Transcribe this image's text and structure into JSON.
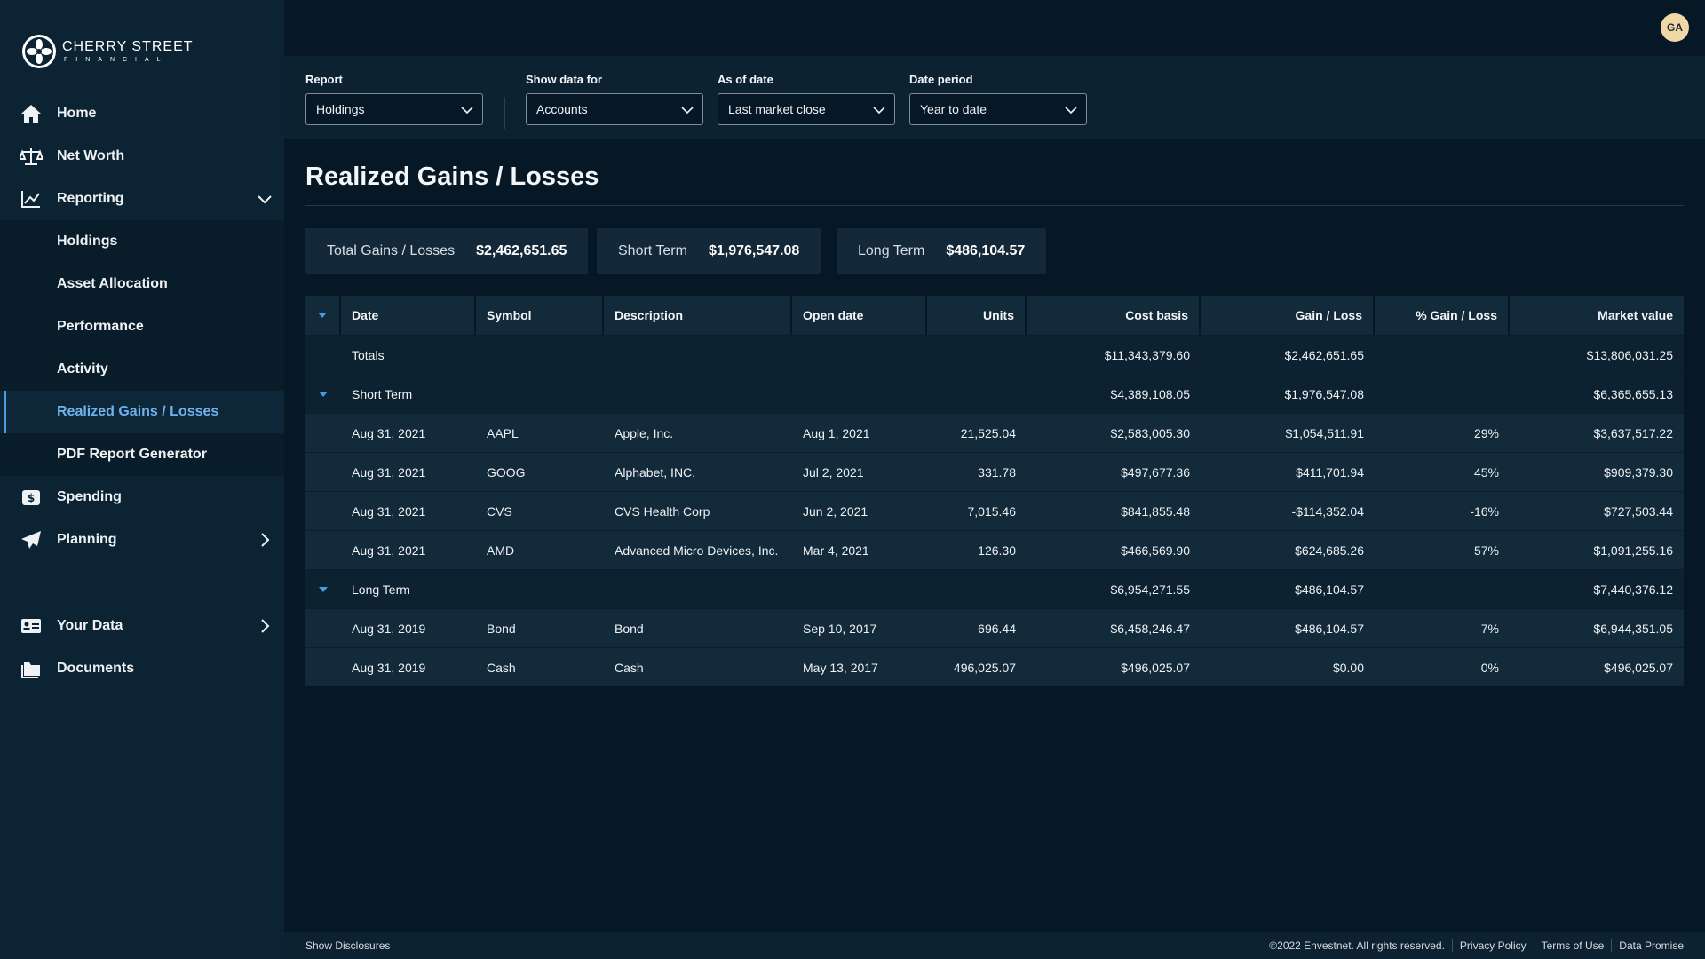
{
  "brand": {
    "line1": "CHERRY STREET",
    "line2": "FINANCIAL"
  },
  "user": {
    "initials": "GA"
  },
  "nav": {
    "home": "Home",
    "net_worth": "Net Worth",
    "reporting": "Reporting",
    "reporting_sub": [
      "Holdings",
      "Asset Allocation",
      "Performance",
      "Activity",
      "Realized Gains / Losses",
      "PDF Report Generator"
    ],
    "spending": "Spending",
    "planning": "Planning",
    "your_data": "Your Data",
    "documents": "Documents"
  },
  "filters": {
    "report": {
      "label": "Report",
      "value": "Holdings"
    },
    "show_data_for": {
      "label": "Show data for",
      "value": "Accounts"
    },
    "as_of_date": {
      "label": "As of date",
      "value": "Last market close"
    },
    "date_period": {
      "label": "Date period",
      "value": "Year to date"
    }
  },
  "page": {
    "title": "Realized Gains / Losses"
  },
  "summary": {
    "total": {
      "label": "Total Gains / Losses",
      "value": "$2,462,651.65"
    },
    "short": {
      "label": "Short Term",
      "value": "$1,976,547.08"
    },
    "long": {
      "label": "Long Term",
      "value": "$486,104.57"
    }
  },
  "table": {
    "headers": [
      "Date",
      "Symbol",
      "Description",
      "Open date",
      "Units",
      "Cost basis",
      "Gain / Loss",
      "%  Gain / Loss",
      "Market value"
    ],
    "totals": {
      "label": "Totals",
      "cost": "$11,343,379.60",
      "gain": "$2,462,651.65",
      "market": "$13,806,031.25"
    },
    "short_group": {
      "label": "Short Term",
      "cost": "$4,389,108.05",
      "gain": "$1,976,547.08",
      "market": "$6,365,655.13"
    },
    "short_rows": [
      {
        "date": "Aug 31, 2021",
        "symbol": "AAPL",
        "desc": "Apple, Inc.",
        "open": "Aug 1, 2021",
        "units": "21,525.04",
        "cost": "$2,583,005.30",
        "gain": "$1,054,511.91",
        "pct": "29%",
        "market": "$3,637,517.22"
      },
      {
        "date": "Aug 31, 2021",
        "symbol": "GOOG",
        "desc": "Alphabet, INC.",
        "open": "Jul 2, 2021",
        "units": "331.78",
        "cost": "$497,677.36",
        "gain": "$411,701.94",
        "pct": "45%",
        "market": "$909,379.30"
      },
      {
        "date": "Aug 31, 2021",
        "symbol": "CVS",
        "desc": "CVS Health Corp",
        "open": "Jun 2, 2021",
        "units": "7,015.46",
        "cost": "$841,855.48",
        "gain": "-$114,352.04",
        "pct": "-16%",
        "market": "$727,503.44"
      },
      {
        "date": "Aug 31, 2021",
        "symbol": "AMD",
        "desc": "Advanced Micro Devices, Inc.",
        "open": "Mar 4, 2021",
        "units": "126.30",
        "cost": "$466,569.90",
        "gain": "$624,685.26",
        "pct": "57%",
        "market": "$1,091,255.16"
      }
    ],
    "long_group": {
      "label": "Long Term",
      "cost": "$6,954,271.55",
      "gain": "$486,104.57",
      "market": "$7,440,376.12"
    },
    "long_rows": [
      {
        "date": "Aug 31, 2019",
        "symbol": "Bond",
        "desc": "Bond",
        "open": "Sep 10, 2017",
        "units": "696.44",
        "cost": "$6,458,246.47",
        "gain": "$486,104.57",
        "pct": "7%",
        "market": "$6,944,351.05"
      },
      {
        "date": "Aug 31, 2019",
        "symbol": "Cash",
        "desc": "Cash",
        "open": "May 13, 2017",
        "units": "496,025.07",
        "cost": "$496,025.07",
        "gain": "$0.00",
        "pct": "0%",
        "market": "$496,025.07"
      }
    ]
  },
  "footer": {
    "disclosures": "Show Disclosures",
    "copyright": "©2022 Envestnet. All rights reserved.",
    "privacy": "Privacy Policy",
    "terms": "Terms of Use",
    "data_promise": "Data Promise"
  },
  "colors": {
    "accent": "#6fb3ee",
    "bg": "#061826",
    "sidebar": "#0c2333"
  }
}
